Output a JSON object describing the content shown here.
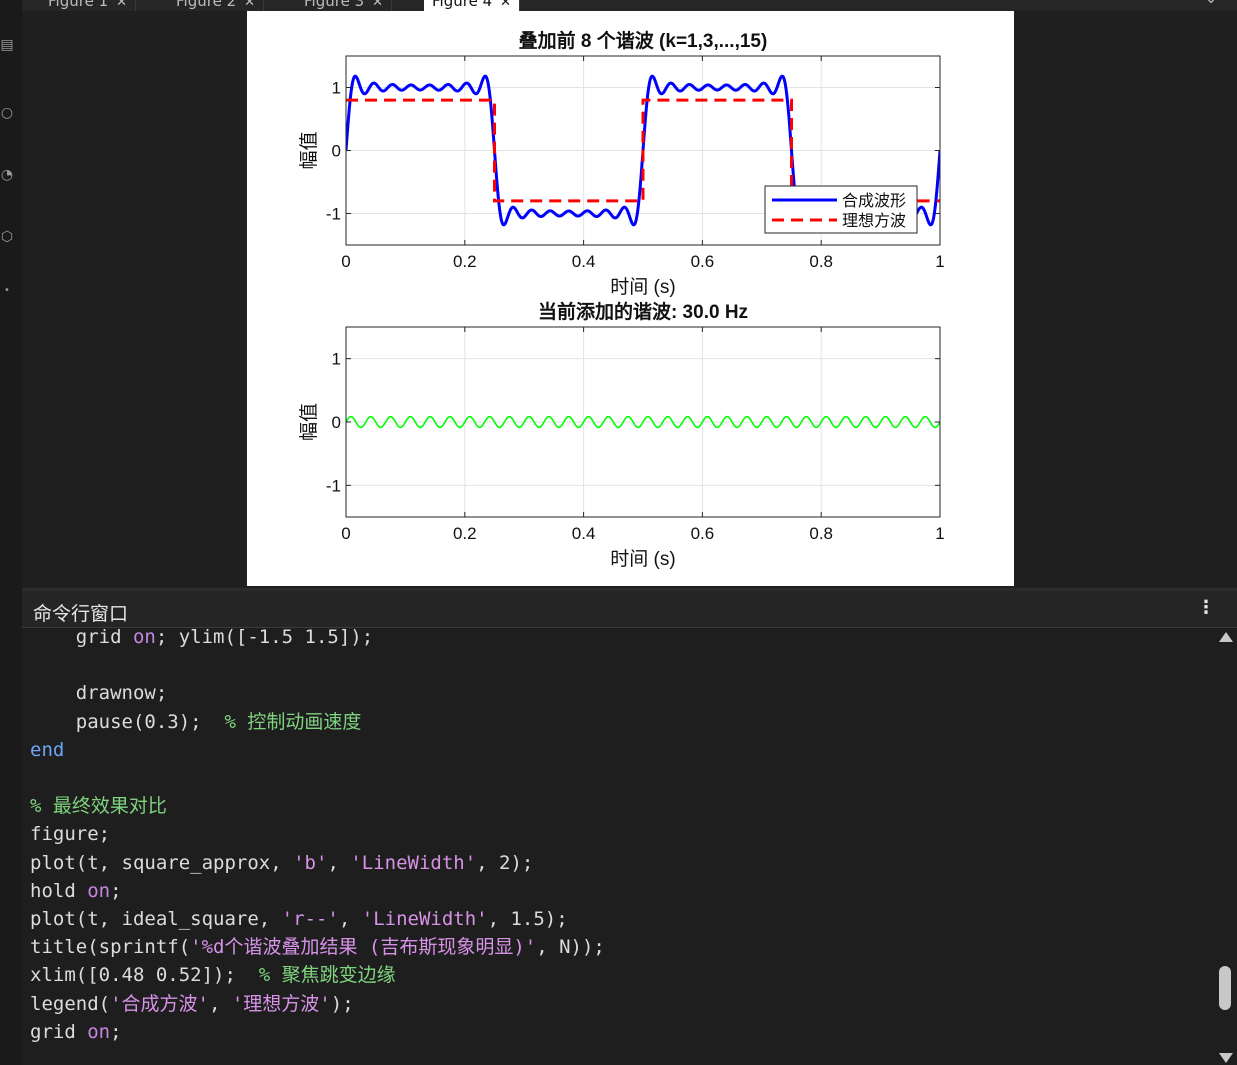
{
  "tabs": [
    {
      "label": "Figure 1",
      "active": false
    },
    {
      "label": "Figure 2",
      "active": false
    },
    {
      "label": "Figure 3",
      "active": false
    },
    {
      "label": "Figure 4",
      "active": true
    }
  ],
  "tab_close_glyph": "✕",
  "figure": {
    "chart_data": [
      {
        "type": "line",
        "title": "叠加前 8 个谐波 (k=1,3,...,15)",
        "xlabel": "时间 (s)",
        "ylabel": "幅值",
        "xlim": [
          0,
          1
        ],
        "ylim": [
          -1.5,
          1.5
        ],
        "xticks": [
          "0",
          "0.2",
          "0.4",
          "0.6",
          "0.8",
          "1"
        ],
        "yticks": [
          "1",
          "0",
          "-1"
        ],
        "grid": true,
        "legend_position": "bottom-right",
        "legend": [
          "合成波形",
          "理想方波"
        ],
        "series": [
          {
            "name": "合成波形",
            "color": "#0000ff",
            "style": "solid",
            "function": "sum of (4/pi)*sin(2*pi*2*k*t)/k for k=1,3,...,15"
          },
          {
            "name": "理想方波",
            "color": "#ff0000",
            "style": "dashed",
            "x": [
              0,
              0.25,
              0.25,
              0.5,
              0.5,
              0.75,
              0.75,
              1.0
            ],
            "y": [
              0.8,
              0.8,
              -0.8,
              -0.8,
              0.8,
              0.8,
              -0.8,
              -0.8
            ]
          }
        ]
      },
      {
        "type": "line",
        "title": "当前添加的谐波: 30.0 Hz",
        "xlabel": "时间 (s)",
        "ylabel": "幅值",
        "xlim": [
          0,
          1
        ],
        "ylim": [
          -1.5,
          1.5
        ],
        "xticks": [
          "0",
          "0.2",
          "0.4",
          "0.6",
          "0.8",
          "1"
        ],
        "yticks": [
          "1",
          "0",
          "-1"
        ],
        "grid": true,
        "series": [
          {
            "color": "#00ff00",
            "style": "solid",
            "frequency_hz": 30,
            "amplitude": 0.085
          }
        ]
      }
    ]
  },
  "command_window": {
    "title": "命令行窗口",
    "menu_glyph": "⋮",
    "lines": [
      [
        {
          "t": "    grid ",
          "c": ""
        },
        {
          "t": "on",
          "c": "kw"
        },
        {
          "t": "; ylim([-1.5 1.5]);",
          "c": ""
        }
      ],
      [],
      [
        {
          "t": "    drawnow;",
          "c": ""
        }
      ],
      [
        {
          "t": "    pause(0.3);  ",
          "c": ""
        },
        {
          "t": "% 控制动画速度",
          "c": "cmt"
        }
      ],
      [
        {
          "t": "end",
          "c": "end"
        }
      ],
      [],
      [
        {
          "t": "% 最终效果对比",
          "c": "cmt"
        }
      ],
      [
        {
          "t": "figure;",
          "c": ""
        }
      ],
      [
        {
          "t": "plot(t, square_approx, ",
          "c": ""
        },
        {
          "t": "'b'",
          "c": "str"
        },
        {
          "t": ", ",
          "c": ""
        },
        {
          "t": "'LineWidth'",
          "c": "str"
        },
        {
          "t": ", 2);",
          "c": ""
        }
      ],
      [
        {
          "t": "hold ",
          "c": ""
        },
        {
          "t": "on",
          "c": "kw"
        },
        {
          "t": ";",
          "c": ""
        }
      ],
      [
        {
          "t": "plot(t, ideal_square, ",
          "c": ""
        },
        {
          "t": "'r--'",
          "c": "str"
        },
        {
          "t": ", ",
          "c": ""
        },
        {
          "t": "'LineWidth'",
          "c": "str"
        },
        {
          "t": ", 1.5);",
          "c": ""
        }
      ],
      [
        {
          "t": "title(sprintf(",
          "c": ""
        },
        {
          "t": "'%d个谐波叠加结果 (吉布斯现象明显)'",
          "c": "str"
        },
        {
          "t": ", N));",
          "c": ""
        }
      ],
      [
        {
          "t": "xlim([0.48 0.52]);  ",
          "c": ""
        },
        {
          "t": "% 聚焦跳变边缘",
          "c": "cmt"
        }
      ],
      [
        {
          "t": "legend(",
          "c": ""
        },
        {
          "t": "'合成方波'",
          "c": "str"
        },
        {
          "t": ", ",
          "c": ""
        },
        {
          "t": "'理想方波'",
          "c": "str"
        },
        {
          "t": ");",
          "c": ""
        }
      ],
      [
        {
          "t": "grid ",
          "c": ""
        },
        {
          "t": "on",
          "c": "kw"
        },
        {
          "t": ";",
          "c": ""
        }
      ]
    ]
  }
}
